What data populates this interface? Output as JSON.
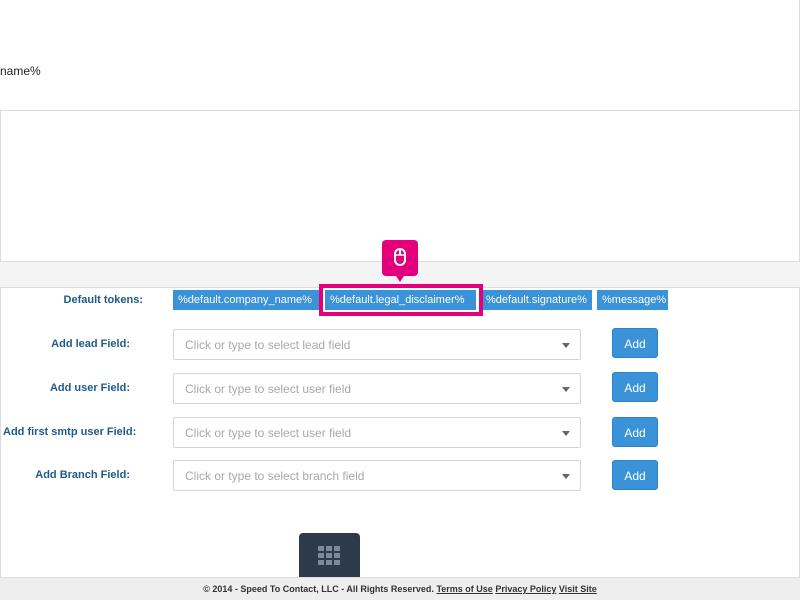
{
  "top_panel": {
    "fragment_text": "name%"
  },
  "tokens": {
    "label": "Default tokens:",
    "items": [
      "%default.company_name%",
      "%default.legal_disclaimer%",
      "%default.signature%",
      "%message%"
    ]
  },
  "fields": [
    {
      "label": "Add lead Field:",
      "placeholder": "Click or type to select lead field",
      "button": "Add"
    },
    {
      "label": "Add user Field:",
      "placeholder": "Click or type to select user field",
      "button": "Add"
    },
    {
      "label": "Add first smtp user Field:",
      "placeholder": "Click or type to select user field",
      "button": "Add"
    },
    {
      "label": "Add Branch Field:",
      "placeholder": "Click or type to select branch field",
      "button": "Add"
    }
  ],
  "footer": {
    "copyright": "© 2014 - Speed To Contact, LLC - All Rights Reserved.",
    "links": [
      "Terms of Use",
      "Privacy Policy",
      "Visit Site"
    ]
  },
  "icons": {
    "cursor": "mouse-icon",
    "apps": "grid-icon"
  },
  "colors": {
    "accent": "#3a92d8",
    "highlight": "#e4007c",
    "label": "#1f5a8c",
    "dark_button": "#2d3a4b"
  }
}
